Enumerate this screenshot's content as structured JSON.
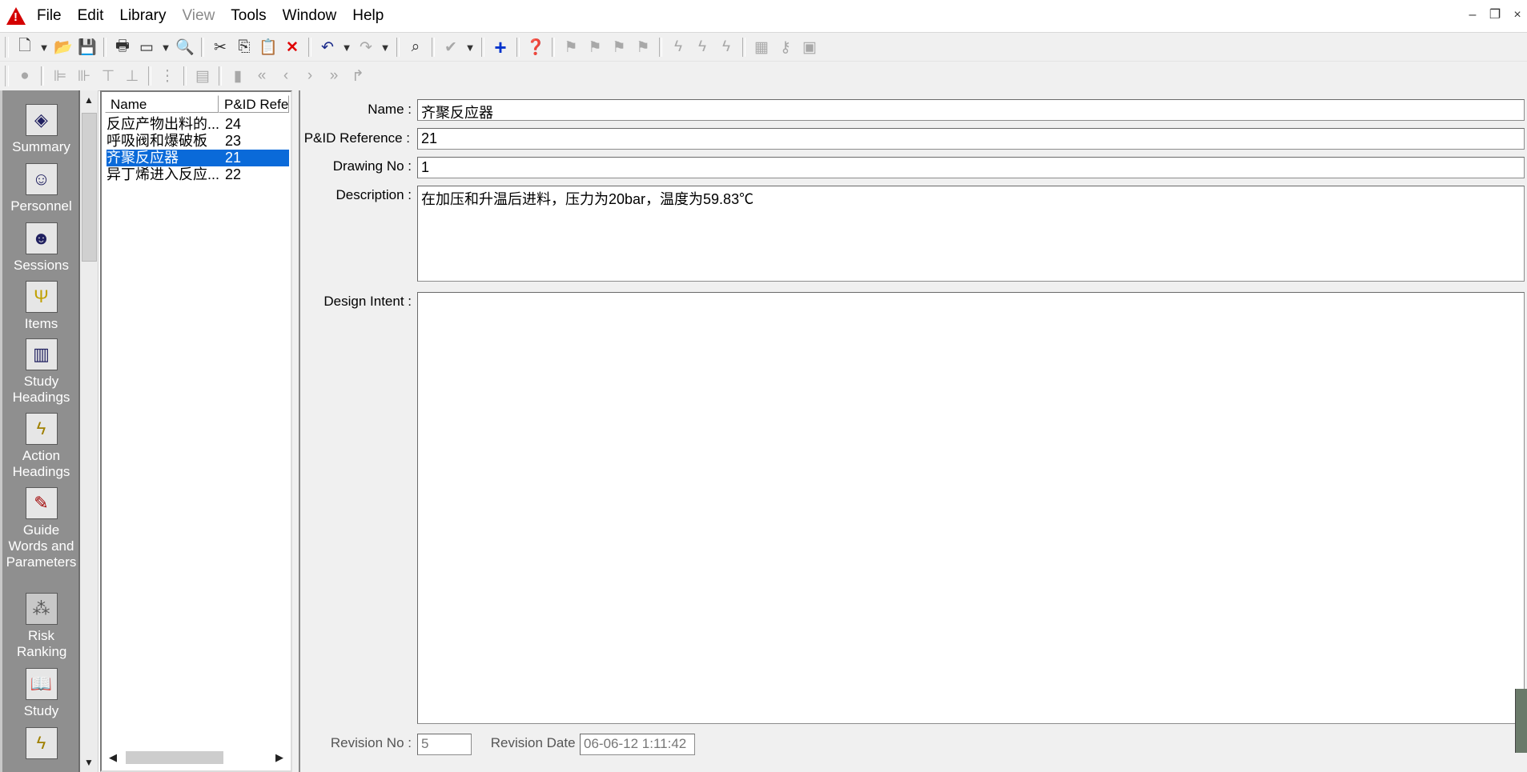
{
  "menu": {
    "items": [
      {
        "label": "File",
        "enabled": true
      },
      {
        "label": "Edit",
        "enabled": true
      },
      {
        "label": "Library",
        "enabled": true
      },
      {
        "label": "View",
        "enabled": false
      },
      {
        "label": "Tools",
        "enabled": true
      },
      {
        "label": "Window",
        "enabled": true
      },
      {
        "label": "Help",
        "enabled": true
      }
    ]
  },
  "nav": {
    "items": [
      {
        "label": "Summary",
        "icon": "summary-icon"
      },
      {
        "label": "Personnel",
        "icon": "personnel-icon"
      },
      {
        "label": "Sessions",
        "icon": "sessions-icon"
      },
      {
        "label": "Items",
        "icon": "items-icon"
      },
      {
        "label": "Study Headings",
        "icon": "study-headings-icon"
      },
      {
        "label": "Action Headings",
        "icon": "action-headings-icon"
      },
      {
        "label": "Guide Words and Parameters",
        "icon": "guide-words-icon"
      },
      {
        "label": "Risk Ranking",
        "icon": "risk-ranking-icon"
      },
      {
        "label": "Study",
        "icon": "study-icon"
      }
    ]
  },
  "list": {
    "col_name": "Name",
    "col_pid": "P&ID Refer",
    "rows": [
      {
        "name": "反应产物出料的...",
        "ref": "24",
        "selected": false
      },
      {
        "name": "呼吸阀和爆破板",
        "ref": "23",
        "selected": false
      },
      {
        "name": "齐聚反应器",
        "ref": "21",
        "selected": true
      },
      {
        "name": "异丁烯进入反应...",
        "ref": "22",
        "selected": false
      }
    ]
  },
  "form": {
    "name_label": "Name :",
    "name_value": "齐聚反应器",
    "pid_label": "P&ID Reference :",
    "pid_value": "21",
    "drawing_label": "Drawing No :",
    "drawing_value": "1",
    "desc_label": "Description :",
    "desc_value": "在加压和升温后进料，压力为20bar，温度为59.83℃",
    "intent_label": "Design Intent :",
    "intent_value": "",
    "revno_label": "Revision No :",
    "revno_value": "5",
    "revdate_label": "Revision Date :",
    "revdate_value": "06-06-12 1:11:42"
  },
  "colors": {
    "selection": "#0a6ad9",
    "navbar": "#8f8f8f",
    "app_icon": "#d40000"
  }
}
